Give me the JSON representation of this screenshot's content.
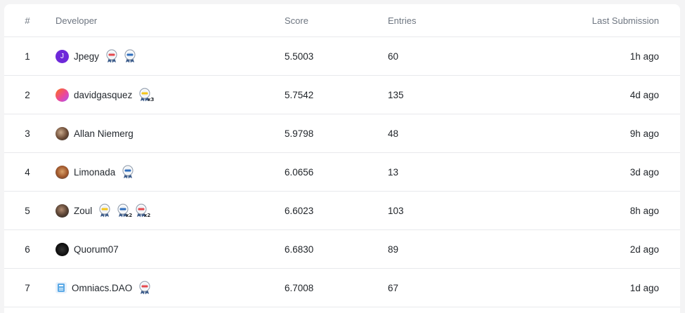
{
  "columns": {
    "rank": "#",
    "developer": "Developer",
    "score": "Score",
    "entries": "Entries",
    "last_submission": "Last Submission"
  },
  "rows": [
    {
      "rank": "1",
      "avatar_letter": "J",
      "developer": "Jpegy",
      "score": "5.5003",
      "entries": "60",
      "last": "1h ago",
      "badges": [
        {
          "icon": "medal-red-icon",
          "mult": ""
        },
        {
          "icon": "medal-blue-icon",
          "mult": ""
        }
      ]
    },
    {
      "rank": "2",
      "avatar_letter": "",
      "developer": "davidgasquez",
      "score": "5.7542",
      "entries": "135",
      "last": "4d ago",
      "badges": [
        {
          "icon": "medal-gold-icon",
          "mult": "x3"
        }
      ]
    },
    {
      "rank": "3",
      "avatar_letter": "",
      "developer": "Allan Niemerg",
      "score": "5.9798",
      "entries": "48",
      "last": "9h ago",
      "badges": []
    },
    {
      "rank": "4",
      "avatar_letter": "",
      "developer": "Limonada",
      "score": "6.0656",
      "entries": "13",
      "last": "3d ago",
      "badges": [
        {
          "icon": "medal-blue-icon",
          "mult": ""
        }
      ]
    },
    {
      "rank": "5",
      "avatar_letter": "",
      "developer": "Zoul",
      "score": "6.6023",
      "entries": "103",
      "last": "8h ago",
      "badges": [
        {
          "icon": "medal-gold-icon",
          "mult": ""
        },
        {
          "icon": "medal-blue-icon",
          "mult": "x2"
        },
        {
          "icon": "medal-red-icon",
          "mult": "x2"
        }
      ]
    },
    {
      "rank": "6",
      "avatar_letter": "",
      "developer": "Quorum07",
      "score": "6.6830",
      "entries": "89",
      "last": "2d ago",
      "badges": []
    },
    {
      "rank": "7",
      "avatar_letter": "",
      "developer": "Omniacs.DAO",
      "score": "6.7008",
      "entries": "67",
      "last": "1d ago",
      "badges": [
        {
          "icon": "medal-red-icon",
          "mult": ""
        }
      ]
    }
  ],
  "colors": {
    "medal_red": "#e5484d",
    "medal_blue": "#2f6ebd",
    "medal_gold": "#f5c518",
    "ribbon": "#3b5b8a"
  }
}
